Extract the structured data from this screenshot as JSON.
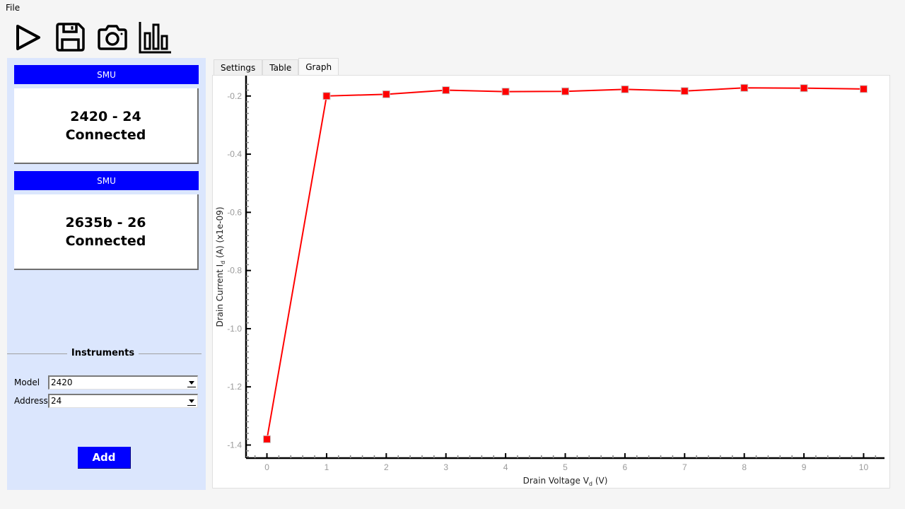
{
  "menubar": {
    "file": "File"
  },
  "toolbar": {
    "buttons": [
      {
        "name": "run",
        "icon": "play-icon"
      },
      {
        "name": "save",
        "icon": "save-icon"
      },
      {
        "name": "screenshot",
        "icon": "camera-icon"
      },
      {
        "name": "chart",
        "icon": "bar-chart-icon"
      }
    ]
  },
  "sidebar": {
    "instruments": [
      {
        "header": "SMU",
        "line1": "2420 - 24",
        "line2": "Connected"
      },
      {
        "header": "SMU",
        "line1": "2635b - 26",
        "line2": "Connected"
      }
    ],
    "group_title": "Instruments",
    "model_label": "Model",
    "model_value": "2420",
    "address_label": "Address",
    "address_value": "24",
    "add_label": "Add"
  },
  "tabs": [
    {
      "label": "Settings",
      "active": false
    },
    {
      "label": "Table",
      "active": false
    },
    {
      "label": "Graph",
      "active": true
    }
  ],
  "colors": {
    "accent": "#0000ff",
    "sidebar_bg": "#dbe6fd",
    "series": "#ff0000"
  },
  "chart_data": {
    "type": "line",
    "title": "",
    "xlabel": "Drain Voltage V",
    "xlabel_sub": "d",
    "xlabel_unit": " (V)",
    "ylabel": "Drain Current I",
    "ylabel_sub": "d",
    "ylabel_unit": " (A) (x1e-09)",
    "xlim": [
      -0.35,
      10.35
    ],
    "ylim": [
      -1.445,
      -0.13
    ],
    "xticks": [
      0,
      1,
      2,
      3,
      4,
      5,
      6,
      7,
      8,
      9,
      10
    ],
    "xtick_labels": [
      "0",
      "1",
      "2",
      "3",
      "4",
      "5",
      "6",
      "7",
      "8",
      "9",
      "10"
    ],
    "yticks": [
      -0.2,
      -0.4,
      -0.6,
      -0.8,
      -1.0,
      -1.2,
      -1.4
    ],
    "ytick_labels": [
      "-0.2",
      "-0.4",
      "-0.6",
      "-0.8",
      "-1.0",
      "-1.2",
      "-1.4"
    ],
    "grid": false,
    "legend": "none",
    "series": [
      {
        "name": "Id",
        "color": "#ff0000",
        "marker": "square",
        "x": [
          0,
          1,
          2,
          3,
          4,
          5,
          6,
          7,
          8,
          9,
          10
        ],
        "y": [
          -1.38,
          -0.2,
          -0.194,
          -0.18,
          -0.185,
          -0.184,
          -0.177,
          -0.183,
          -0.172,
          -0.173,
          -0.176
        ]
      }
    ]
  }
}
